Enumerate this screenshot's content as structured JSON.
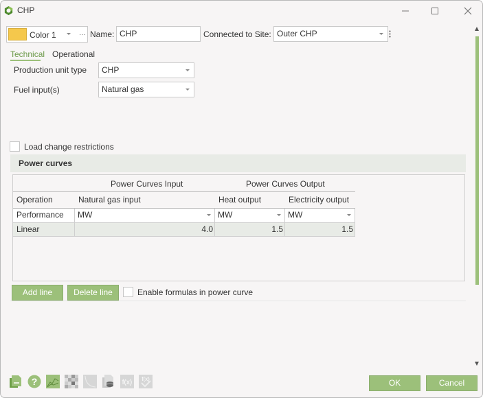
{
  "window": {
    "title": "CHP",
    "controls": {
      "minimize": "minimize-icon",
      "maximize": "maximize-icon",
      "close": "close-icon"
    }
  },
  "header": {
    "color_label": "Color 1",
    "color_swatch": "#f5c84c",
    "more_label": "···",
    "name_label": "Name:",
    "name_value": "CHP",
    "site_label": "Connected to Site:",
    "site_value": "Outer CHP"
  },
  "tabs": [
    {
      "label": "Technical",
      "active": true
    },
    {
      "label": "Operational",
      "active": false
    }
  ],
  "technical": {
    "production_unit_type_label": "Production unit type",
    "production_unit_type_value": "CHP",
    "fuel_inputs_label": "Fuel input(s)",
    "fuel_inputs_value": "Natural gas",
    "load_change_label": "Load change restrictions",
    "load_change_checked": false
  },
  "power_curves": {
    "section_title": "Power curves",
    "group_headers": {
      "input": "Power Curves Input",
      "output": "Power Curves Output"
    },
    "columns": [
      "Operation",
      "Natural gas input",
      "Heat output",
      "Electricity output"
    ],
    "unit_row": {
      "label": "Performance",
      "units": [
        "MW",
        "MW",
        "MW"
      ]
    },
    "rows": [
      {
        "operation": "Linear",
        "values": [
          "4.0",
          "1.5",
          "1.5"
        ]
      }
    ],
    "add_line_label": "Add line",
    "delete_line_label": "Delete line",
    "enable_formulas_label": "Enable formulas in power curve",
    "enable_formulas_checked": false
  },
  "footer": {
    "tools": [
      "export-icon",
      "help-icon",
      "chart-icon",
      "pattern-icon",
      "curve-icon",
      "database-icon",
      "function-icon",
      "function-check-icon"
    ],
    "ok_label": "OK",
    "cancel_label": "Cancel"
  },
  "colors": {
    "accent": "#9cc07a",
    "accent_text": "#6d9a4a"
  }
}
